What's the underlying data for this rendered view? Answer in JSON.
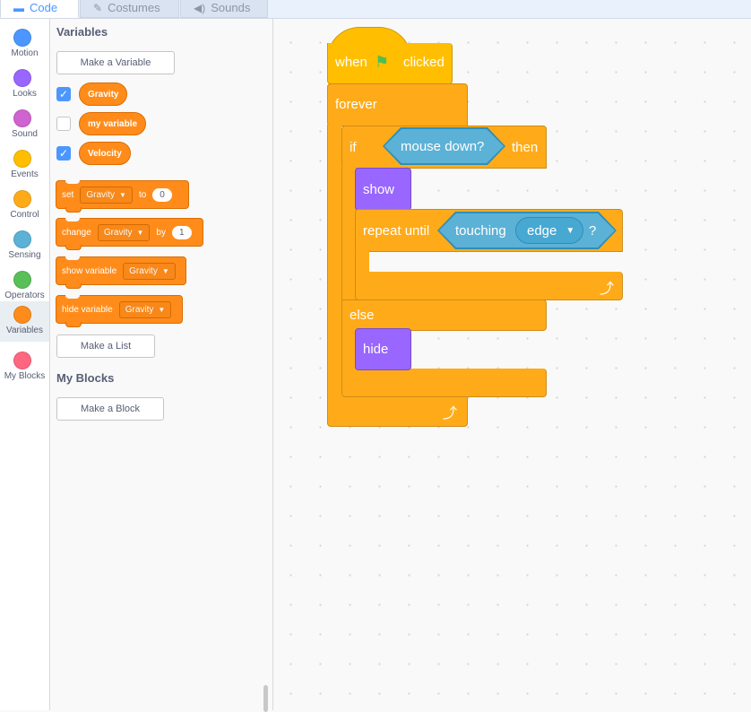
{
  "tabs": [
    {
      "label": "Code",
      "icon": "code-icon"
    },
    {
      "label": "Costumes",
      "icon": "brush-icon"
    },
    {
      "label": "Sounds",
      "icon": "speaker-icon"
    }
  ],
  "categories": [
    {
      "label": "Motion",
      "color": "#4c97ff"
    },
    {
      "label": "Looks",
      "color": "#9966ff"
    },
    {
      "label": "Sound",
      "color": "#cf63cf"
    },
    {
      "label": "Events",
      "color": "#ffbf00"
    },
    {
      "label": "Control",
      "color": "#ffab19"
    },
    {
      "label": "Sensing",
      "color": "#5cb1d6"
    },
    {
      "label": "Operators",
      "color": "#59c059"
    },
    {
      "label": "Variables",
      "color": "#ff8c1a"
    },
    {
      "label": "My Blocks",
      "color": "#ff6680"
    }
  ],
  "palette": {
    "variables_title": "Variables",
    "make_variable": "Make a Variable",
    "variables": [
      {
        "name": "Gravity",
        "checked": true
      },
      {
        "name": "my variable",
        "checked": false
      },
      {
        "name": "Velocity",
        "checked": true
      }
    ],
    "set_block": {
      "label": "set",
      "var": "Gravity",
      "to": "to",
      "value": "0"
    },
    "change_block": {
      "label": "change",
      "var": "Gravity",
      "by": "by",
      "value": "1"
    },
    "show_var_block": {
      "label": "show variable",
      "var": "Gravity"
    },
    "hide_var_block": {
      "label": "hide variable",
      "var": "Gravity"
    },
    "make_list": "Make a List",
    "myblocks_title": "My Blocks",
    "make_block": "Make a Block"
  },
  "script": {
    "hat": {
      "when": "when",
      "clicked": "clicked"
    },
    "forever": "forever",
    "if": "if",
    "condition": "mouse down?",
    "then": "then",
    "show": "show",
    "repeat_until": "repeat until",
    "touching": "touching",
    "touching_target": "edge",
    "question": "?",
    "else": "else",
    "hide": "hide"
  }
}
